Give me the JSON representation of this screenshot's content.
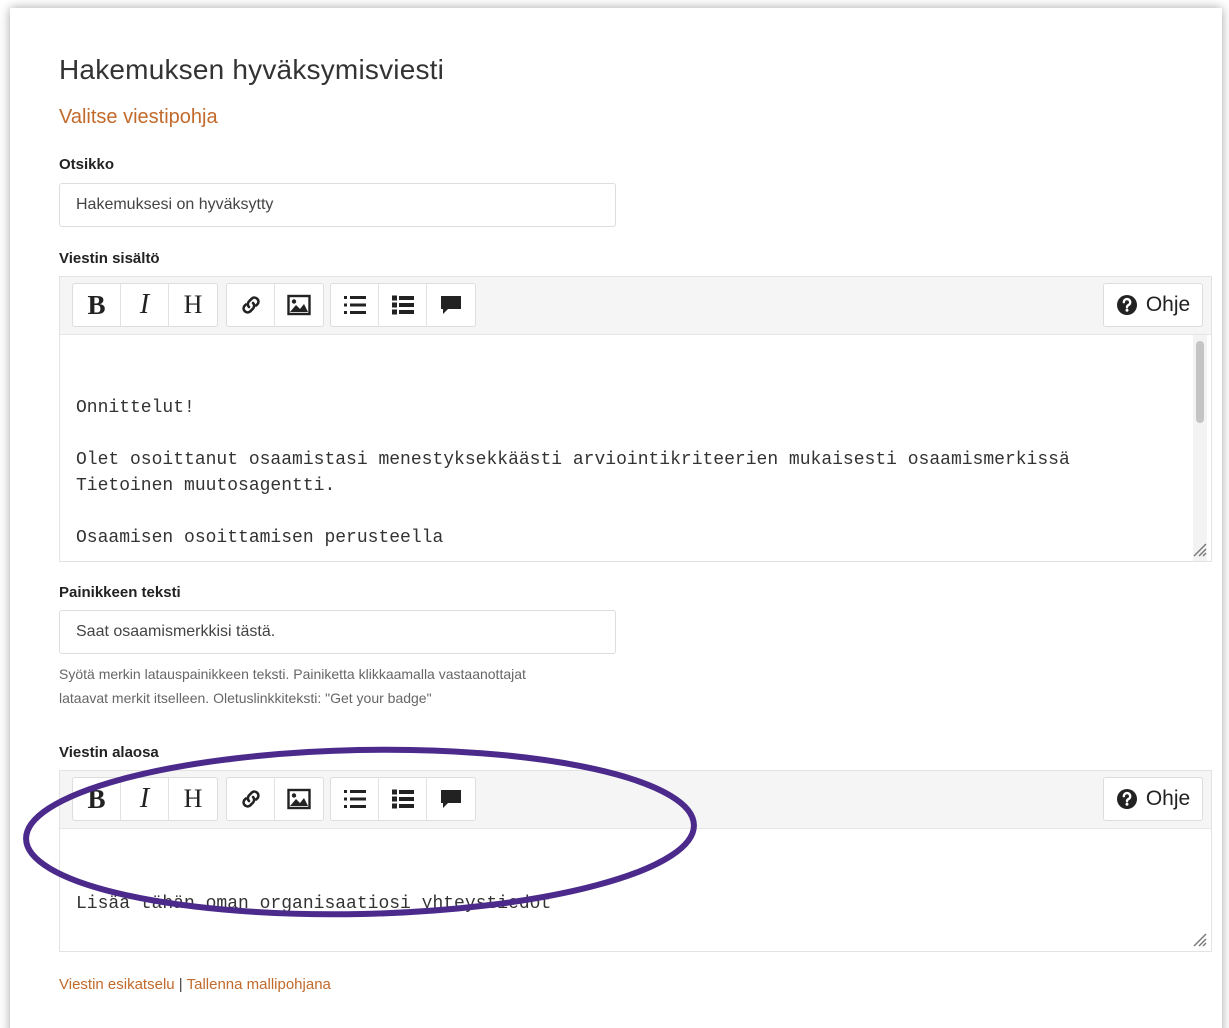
{
  "page": {
    "title": "Hakemuksen hyväksymisviesti",
    "template_link": "Valitse viestipohja"
  },
  "subject": {
    "label": "Otsikko",
    "value": "Hakemuksesi on hyväksytty"
  },
  "content": {
    "label": "Viestin sisältö",
    "text": "Onnittelut!\n\nOlet osoittanut osaamistasi menestyksekkäästi arviointikriteerien mukaisesti osaamismerkissä\nTietoinen muutosagentti.\n\nOsaamisen osoittamisen perusteella\n\n– artikuloit ja reflektoit asemaasi muutosagenttina omassa koulutuskontekstissasi\n– määrität toiminnallisia tavoitteita ja valitset menetelmiä oman toimintasi kehittämiseen"
  },
  "toolbar": {
    "bold_label": "B",
    "italic_label": "I",
    "heading_label": "H",
    "help_label": "Ohje",
    "icons": [
      "link-icon",
      "image-icon",
      "ordered-list-icon",
      "unordered-list-icon",
      "comment-icon",
      "question-circle-icon"
    ]
  },
  "button_text": {
    "label": "Painikkeen teksti",
    "value": "Saat osaamismerkkisi tästä.",
    "hint_line1": "Syötä merkin latauspainikkeen teksti. Painiketta klikkaamalla vastaanottajat",
    "hint_line2": "lataavat merkit itselleen. Oletuslinkkiteksti: \"Get your badge\""
  },
  "footer_section": {
    "label": "Viestin alaosa",
    "text": "Lisää tähän oman organisaatiosi yhteystiedot"
  },
  "footer_links": {
    "preview": "Viestin esikatselu",
    "separator": "|",
    "save_template": "Tallenna mallipohjana"
  },
  "colors": {
    "accent": "#c26a2b",
    "highlight": "#4b2a8c"
  }
}
